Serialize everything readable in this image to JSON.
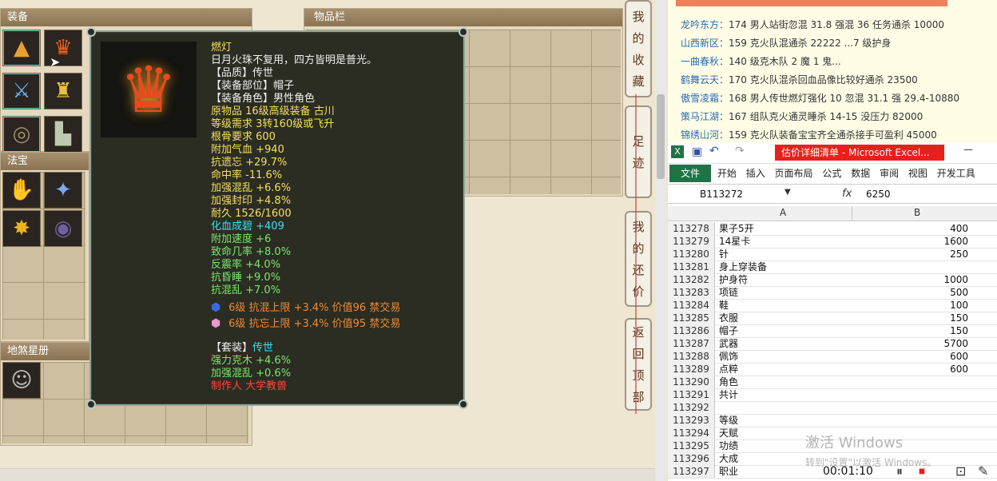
{
  "panels": {
    "equipment": "装备",
    "magic": "法宝",
    "star_book": "地煞星册",
    "inventory": "物品栏"
  },
  "tooltip": {
    "name": "燃灯",
    "desc": "日月火珠不复用，四方皆明是普光。",
    "quality": "【品质】传世",
    "slot": "【装备部位】帽子",
    "role": "【装备角色】男性角色",
    "origin": "原物品 16级高级装备 古川",
    "level_req": "等级需求 3转160级或飞升",
    "bone_req": "根骨要求 600",
    "stats": [
      {
        "text": "附加气血 +940",
        "color": "y"
      },
      {
        "text": "抗遗忘 +29.7%",
        "color": "y"
      },
      {
        "text": "命中率 -11.6%",
        "color": "y"
      },
      {
        "text": "加强混乱 +6.6%",
        "color": "y"
      },
      {
        "text": "加强封印 +4.8%",
        "color": "y"
      },
      {
        "text": "耐久 1526/1600",
        "color": "y"
      },
      {
        "text": "化血成碧 +409",
        "color": "c"
      },
      {
        "text": "附加速度 +6",
        "color": "g"
      },
      {
        "text": "致命几率 +8.0%",
        "color": "g"
      },
      {
        "text": "反震率 +4.0%",
        "color": "g"
      },
      {
        "text": "抗昏睡 +9.0%",
        "color": "g"
      },
      {
        "text": "抗混乱 +7.0%",
        "color": "g"
      }
    ],
    "gems": [
      {
        "text": "6级 抗混上限 +3.4% 价值96 禁交易",
        "color": "#3a6ae0"
      },
      {
        "text": "6级 抗忘上限 +3.4% 价值95 禁交易",
        "color": "#e69ad0"
      }
    ],
    "set_label": "【套装】",
    "set_value": "传世",
    "set_stats": [
      "强力克木 +4.6%",
      "加强混乱 +0.6%"
    ],
    "maker": "制作人 大学教兽"
  },
  "side_buttons": [
    {
      "label": "我的收藏",
      "chars": [
        "我",
        "的",
        "收",
        "藏"
      ]
    },
    {
      "label": "足迹",
      "chars": [
        "足",
        "迹"
      ]
    },
    {
      "label": "我的还价",
      "chars": [
        "我",
        "的",
        "还",
        "价"
      ]
    },
    {
      "label": "返回顶部",
      "chars": [
        "返",
        "回",
        "顶",
        "部"
      ]
    }
  ],
  "listing": {
    "rows": [
      {
        "k": "龙吟东方：",
        "v": "174 男人站街忽混 31.8 强混 36 任务通杀 10000"
      },
      {
        "k": "山西新区：",
        "v": "159 克火队混通杀 22222 ...7 级护身"
      },
      {
        "k": "一曲春秋：",
        "v": "140 级克木队 2 魔 1 鬼..."
      },
      {
        "k": "鹤舞云天：",
        "v": "170 克火队混杀回血品像比较好通杀 23500"
      },
      {
        "k": "傲雪凌霜：",
        "v": "168 男人传世燃灯强化 10 忽混 31.1 强 29.4-10880"
      },
      {
        "k": "策马江湖：",
        "v": "167 组队克火通灵睡杀 14-15 没压力 82000"
      },
      {
        "k": "锦绣山河：",
        "v": "159 克火队装备宝宝齐全通杀接手可盈利 45000"
      }
    ]
  },
  "excel": {
    "title": "估价详细清单 - Microsoft Excel...",
    "tabs": [
      "文件",
      "开始",
      "插入",
      "页面布局",
      "公式",
      "数据",
      "审阅",
      "视图",
      "开发工具"
    ],
    "namebox": "B113272",
    "fx": "fx",
    "formula": "6250",
    "col_a": "A",
    "col_b": "B",
    "rows": [
      {
        "n": "113278",
        "a": "果子5开",
        "b": "400"
      },
      {
        "n": "113279",
        "a": "14星卡",
        "b": "1600"
      },
      {
        "n": "113280",
        "a": "针",
        "b": "250"
      },
      {
        "n": "113281",
        "a": "身上穿装备",
        "b": ""
      },
      {
        "n": "113282",
        "a": "护身符",
        "b": "1000"
      },
      {
        "n": "113283",
        "a": "项链",
        "b": "500"
      },
      {
        "n": "113284",
        "a": "鞋",
        "b": "100"
      },
      {
        "n": "113285",
        "a": "衣服",
        "b": "150"
      },
      {
        "n": "113286",
        "a": "帽子",
        "b": "150"
      },
      {
        "n": "113287",
        "a": "武器",
        "b": "5700"
      },
      {
        "n": "113288",
        "a": "佩饰",
        "b": "600"
      },
      {
        "n": "113289",
        "a": "点粹",
        "b": "600"
      },
      {
        "n": "113290",
        "a": "角色",
        "b": ""
      },
      {
        "n": "113291",
        "a": "共计",
        "b": ""
      },
      {
        "n": "113292",
        "a": "",
        "b": ""
      },
      {
        "n": "113293",
        "a": "等级",
        "b": ""
      },
      {
        "n": "113294",
        "a": "天赋",
        "b": ""
      },
      {
        "n": "113295",
        "a": "功绩",
        "b": ""
      },
      {
        "n": "113296",
        "a": "大成",
        "b": ""
      },
      {
        "n": "113297",
        "a": "职业",
        "b": ""
      }
    ]
  },
  "watermark": {
    "line1": "激活 Windows",
    "line2": "转到\"设置\"以激活 Windows。"
  },
  "recorder": {
    "time": "00:01:10"
  },
  "colors": {
    "accent_red": "#e8201c",
    "excel_green": "#217346",
    "tooltip_bg": "#2b2c22"
  }
}
